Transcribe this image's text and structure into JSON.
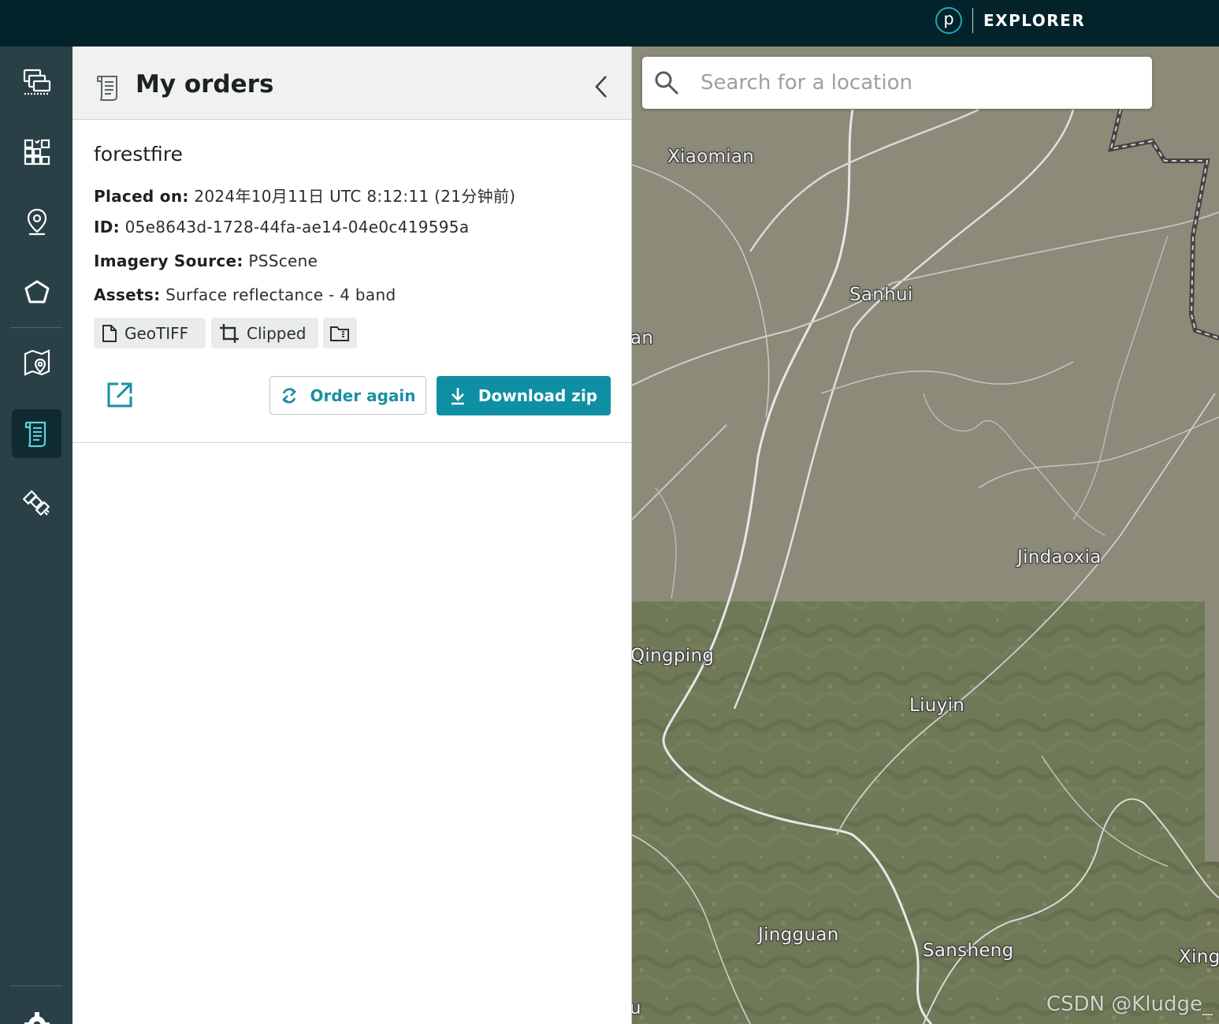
{
  "topbar": {
    "logo_letter": "p",
    "brand_name": "EXPLORER"
  },
  "rail": {
    "items": [
      {
        "icon": "multi-window-icon",
        "active": false
      },
      {
        "icon": "qr-grid-icon",
        "active": false
      },
      {
        "icon": "location-pin-icon",
        "active": false
      },
      {
        "icon": "polygon-icon",
        "active": false
      },
      {
        "icon": "map-pin-icon",
        "active": false
      },
      {
        "icon": "orders-receipt-icon",
        "active": true
      },
      {
        "icon": "satellite-icon",
        "active": false
      },
      {
        "icon": "gear-icon",
        "active": false
      }
    ]
  },
  "panel": {
    "title": "My orders"
  },
  "order": {
    "name": "forestfire",
    "placed_label": "Placed on:",
    "placed_value": "2024年10月11日 UTC 8:12:11 (21分钟前)",
    "id_label": "ID:",
    "id_value": "05e8643d-1728-44fa-ae14-04e0c419595a",
    "source_label": "Imagery Source:",
    "source_value": "PSScene",
    "assets_label": "Assets:",
    "assets_value": "Surface reflectance - 4 band",
    "chips": {
      "format": "GeoTIFF",
      "clip": "Clipped"
    },
    "order_again_label": "Order again",
    "download_label": "Download zip"
  },
  "map": {
    "search_placeholder": "Search for a location",
    "labels": {
      "xiaomian": "Xiaomian",
      "sanhui": "Sanhui",
      "an": "an",
      "jindaoxia": "Jindaoxia",
      "qingping": "Qingping",
      "liuyin": "Liuyin",
      "jingguan": "Jingguan",
      "sansheng": "Sansheng",
      "xing": "Xing",
      "u": "u"
    },
    "watermark": "CSDN @Kludge_"
  },
  "colors": {
    "topbar": "#02232a",
    "rail": "#294046",
    "accent": "#0e8fa3",
    "panel_header": "#f0f1f0"
  }
}
